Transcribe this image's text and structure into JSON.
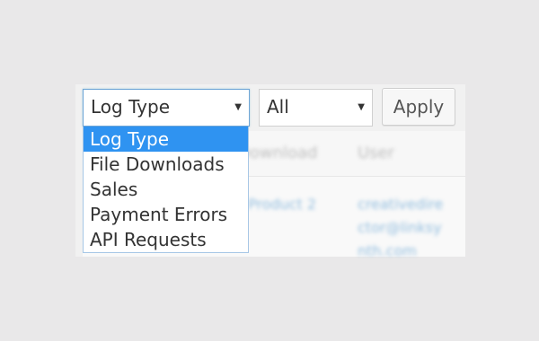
{
  "filters": {
    "log_type": {
      "selected": "Log Type",
      "options": [
        "Log Type",
        "File Downloads",
        "Sales",
        "Payment Errors",
        "API Requests"
      ],
      "selected_index": 0
    },
    "status": {
      "selected": "All"
    },
    "apply_label": "Apply"
  },
  "table": {
    "headers": [
      "Download",
      "User"
    ],
    "row_product": "Product 2",
    "row_user_lines": [
      "creativedire",
      "ctor@linksy",
      "nth.com"
    ]
  },
  "icons": {
    "dropdown_arrow": "triangle-down-icon"
  },
  "colors": {
    "accent": "#2f93f1",
    "focus_border": "#6da5d6",
    "link": "#86b6db"
  }
}
